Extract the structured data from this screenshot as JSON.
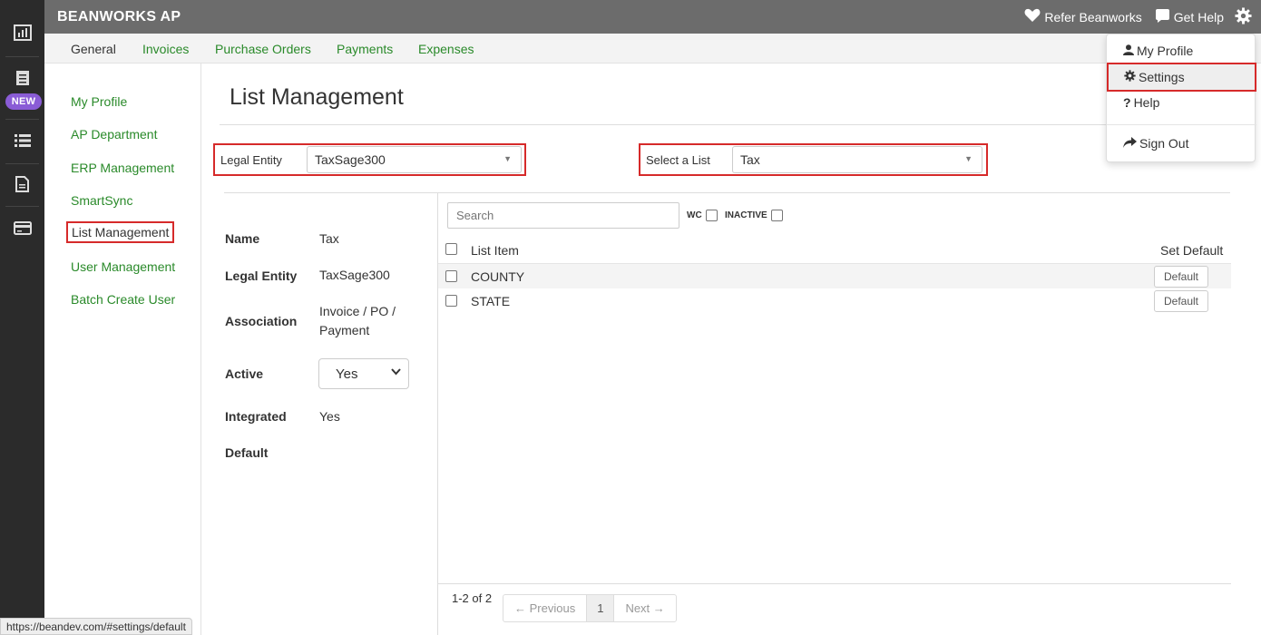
{
  "app": {
    "brand": "BEANWORKS AP"
  },
  "rail": {
    "new_badge": "NEW",
    "icons": [
      "bar-chart-icon",
      "document-list-icon",
      "list-icon",
      "file-icon",
      "credit-card-icon"
    ]
  },
  "topbar": {
    "refer": "Refer Beanworks",
    "help": "Get Help"
  },
  "subnav": {
    "tabs": [
      "General",
      "Invoices",
      "Purchase Orders",
      "Payments",
      "Expenses"
    ]
  },
  "sidenav": {
    "items": [
      "My Profile",
      "AP Department",
      "ERP Management",
      "SmartSync",
      "List Management",
      "User Management",
      "Batch Create User"
    ]
  },
  "page": {
    "title": "List Management"
  },
  "filters": {
    "legal_entity_label": "Legal Entity",
    "legal_entity_value": "TaxSage300",
    "list_label": "Select a List",
    "list_value": "Tax"
  },
  "details": {
    "name_label": "Name",
    "name_value": "Tax",
    "entity_label": "Legal Entity",
    "entity_value": "TaxSage300",
    "assoc_label": "Association",
    "assoc_line1": "Invoice / PO /",
    "assoc_line2": "Payment",
    "active_label": "Active",
    "active_value": "Yes",
    "integrated_label": "Integrated",
    "integrated_value": "Yes",
    "default_label": "Default"
  },
  "list": {
    "search_placeholder": "Search",
    "wc_label": "WC",
    "inactive_label": "INACTIVE",
    "col_item": "List Item",
    "col_default": "Set Default",
    "rows": [
      {
        "name": "COUNTY",
        "button": "Default"
      },
      {
        "name": "STATE",
        "button": "Default"
      }
    ],
    "pager_count": "1-2 of 2",
    "prev": "← Previous",
    "page": "1",
    "next": "Next →"
  },
  "dropdown": {
    "profile": "My Profile",
    "settings": "Settings",
    "help": "Help",
    "signout": "Sign Out"
  },
  "status_url": "https://beandev.com/#settings/default",
  "colors": {
    "accent_green": "#2a8a2a",
    "highlight_red": "#d62a2a",
    "topbar": "#6c6c6c",
    "rail": "#2b2b2b",
    "badge": "#8a5cd6"
  }
}
